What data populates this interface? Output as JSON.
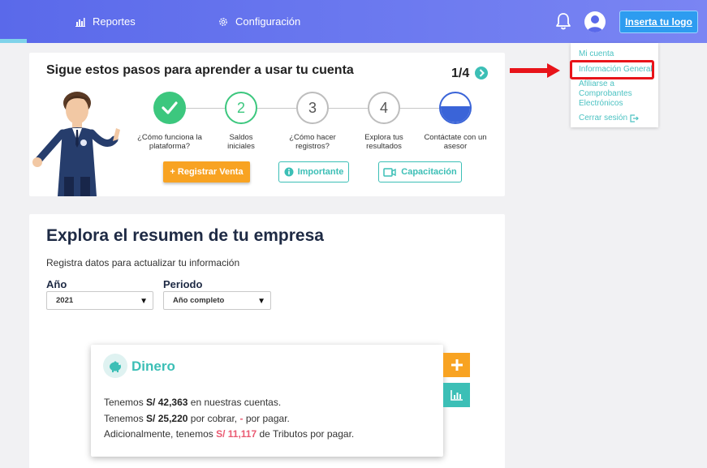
{
  "nav": {
    "reports_label": "Reportes",
    "reports_icon": "bar-chart-icon",
    "config_label": "Configuración",
    "config_icon": "gear-icon",
    "logo_button": "Inserta tu logo"
  },
  "user_menu": {
    "items": [
      "Mi cuenta",
      "Información General",
      "Afiliarse a Comprobantes Electrónicos",
      "Cerrar sesión"
    ],
    "highlighted": "Información General"
  },
  "onboarding": {
    "title": "Sigue estos pasos para aprender a usar tu cuenta",
    "step_count": "1/4",
    "steps": [
      {
        "number": "",
        "label": "¿Cómo funciona la plataforma?",
        "state": "done"
      },
      {
        "number": "2",
        "label": "Saldos iniciales",
        "state": "current"
      },
      {
        "number": "3",
        "label": "¿Cómo hacer registros?",
        "state": "pending"
      },
      {
        "number": "4",
        "label": "Explora tus resultados",
        "state": "pending"
      },
      {
        "number": "",
        "label": "Contáctate con un asesor",
        "state": "contact"
      }
    ],
    "buttons": {
      "register_sale": "+ Registrar Venta",
      "important": "Importante",
      "training": "Capacitación"
    }
  },
  "summary": {
    "title": "Explora el resumen de tu empresa",
    "subtitle": "Registra datos para actualizar tu información",
    "year_label": "Año",
    "year_value": "2021",
    "period_label": "Periodo",
    "period_value": "Año completo"
  },
  "money": {
    "title": "Dinero",
    "line1_pre": "Tenemos",
    "line1_amount": "S/ 42,363",
    "line1_post": "en nuestras cuentas.",
    "line2_pre": "Tenemos",
    "line2_amount": "S/ 25,220",
    "line2_mid": "por cobrar,",
    "line2_dash": "-",
    "line2_post": "por pagar.",
    "line3_pre": "Adicionalmente, tenemos",
    "line3_amount": "S/ 11,117",
    "line3_post": "de Tributos por pagar."
  },
  "colors": {
    "primary": "#5a69ea",
    "teal": "#3cbfb6",
    "orange": "#f8a322",
    "highlight_red": "#e8141a",
    "negative": "#ea5a72"
  }
}
